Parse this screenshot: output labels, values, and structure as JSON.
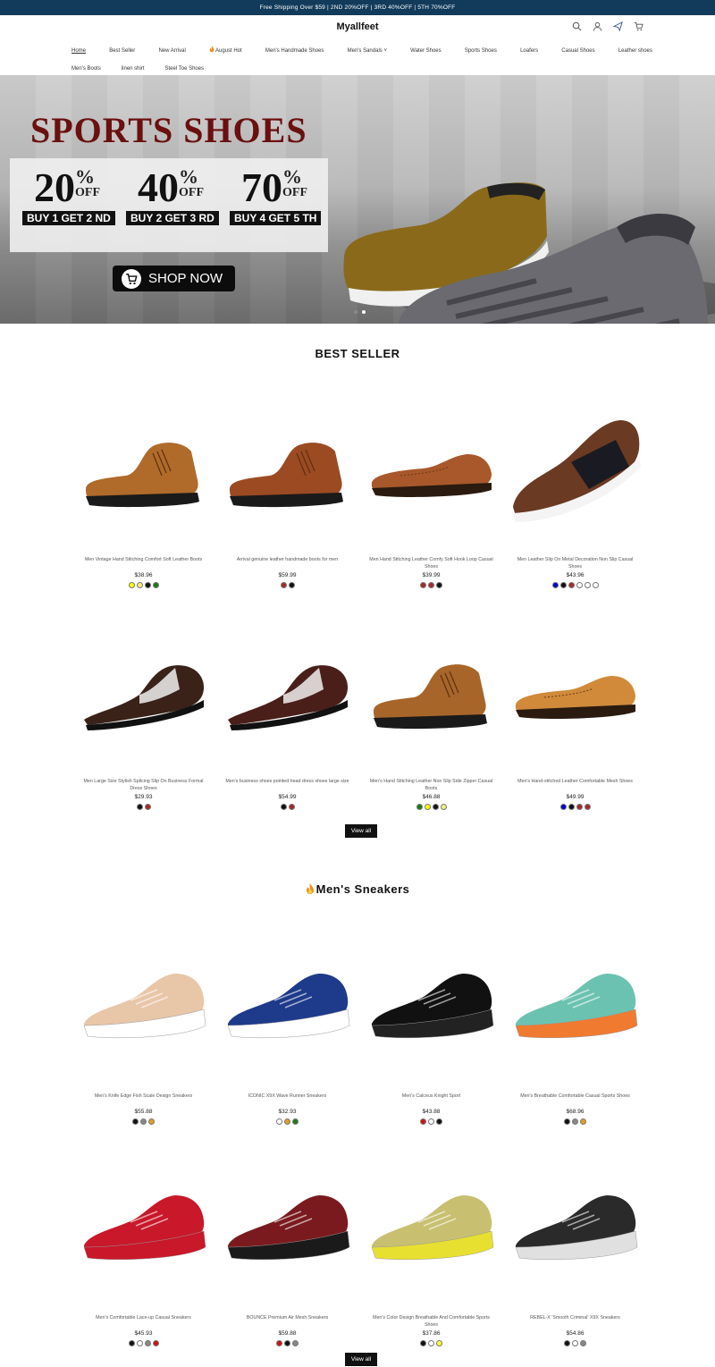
{
  "announcement": "Free Shipping Over $59 | 2ND 20%OFF | 3RD 40%OFF | 5TH 70%OFF",
  "brand": {
    "logo_text": "Myallfeet"
  },
  "nav": {
    "row1": [
      "Home",
      "Best Seller",
      "New Arrival",
      "August Hot",
      "Men's Handmade Shoes",
      "Men's Sandals",
      "Water Shoes",
      "Sports Shoes",
      "Loafers",
      "Casual Shoes",
      "Leather shoes"
    ],
    "row2": [
      "Men's Boots",
      "linen shirt",
      "Steel Toe Shoes"
    ]
  },
  "hero": {
    "title": "SPORTS SHOES",
    "offers": [
      {
        "pct": "20",
        "off": "OFF",
        "buy": "BUY 1 GET 2 ND"
      },
      {
        "pct": "40",
        "off": "OFF",
        "buy": "BUY 2 GET 3 RD"
      },
      {
        "pct": "70",
        "off": "OFF",
        "buy": "BUY 4 GET 5 TH"
      }
    ],
    "cta": "SHOP NOW",
    "slides": 2,
    "active_slide": 2
  },
  "best_seller": {
    "title": "BEST SELLER",
    "view_all": "View all",
    "products": [
      {
        "name": "Men Vintage Hand Stitching Comfort Soft Leather Boots",
        "price": "$38.96",
        "colors": [
          "#ffff00",
          "#f2ee7a",
          "#111111",
          "#1a7a1a"
        ],
        "shoe": {
          "type": "boot",
          "color": "#b06a2a"
        }
      },
      {
        "name": "Arrival genuine leather handmade boots for men",
        "price": "$59.99",
        "colors": [
          "#a52a2a",
          "#111111"
        ],
        "shoe": {
          "type": "boot",
          "color": "#9c4a22"
        }
      },
      {
        "name": "Men Hand Stitching Leather Comfy Soft Hook Loop Casual Shoes",
        "price": "$39.99",
        "colors": [
          "#a52a2a",
          "#a52a2a",
          "#111111"
        ],
        "shoe": {
          "type": "loafer",
          "color": "#a8582a"
        }
      },
      {
        "name": "Men Leather Slip On Metal Decoration Non Slip Casual Shoes",
        "price": "$43.96",
        "colors": [
          "#0000cc",
          "#111111",
          "#a52a2a",
          "#ffffff",
          "#ffffff",
          "#ffffff"
        ],
        "shoe": {
          "type": "slipon",
          "color": "#6b3a22"
        }
      },
      {
        "name": "Men Large Size Stylish Splicing Slip On Business Formal Dress Shoes",
        "price": "$29.93",
        "colors": [
          "#111111",
          "#a52a2a"
        ],
        "shoe": {
          "type": "dress",
          "color": "#3a2218"
        }
      },
      {
        "name": "Men's business shoes pointed head dress shoes large size",
        "price": "$54.99",
        "colors": [
          "#111111",
          "#a52a2a"
        ],
        "shoe": {
          "type": "dress",
          "color": "#4a1f1a"
        }
      },
      {
        "name": "Men's Hand Stitching Leather Non Slip Side Zipper Casual Boots",
        "price": "$46.88",
        "colors": [
          "#1a7a1a",
          "#ffff00",
          "#111111",
          "#f2ee7a"
        ],
        "shoe": {
          "type": "boot",
          "color": "#a8652a"
        }
      },
      {
        "name": "Men's Hand-stitched Leather Comfortable Mesh Shoes",
        "price": "$49.99",
        "colors": [
          "#0000cc",
          "#111111",
          "#a52a2a",
          "#a52a2a"
        ],
        "shoe": {
          "type": "loafer",
          "color": "#d08a3a"
        }
      }
    ]
  },
  "sneakers": {
    "title": "Men's Sneakers",
    "view_all": "View all",
    "products": [
      {
        "name": "Men's Knife Edge Fish Scale Design Sneakers",
        "price": "$55.88",
        "colors": [
          "#111111",
          "#888888",
          "#e0a020"
        ],
        "shoe": {
          "type": "sneaker",
          "color": "#e8c6a8",
          "sole": "#ffffff"
        }
      },
      {
        "name": "ICONIC X9X Wave Runner Sneakers",
        "price": "$32.93",
        "colors": [
          "#ffffff",
          "#e0a020",
          "#1a7a1a"
        ],
        "shoe": {
          "type": "sneaker",
          "color": "#1e3a8a",
          "sole": "#ffffff"
        }
      },
      {
        "name": "Men's Calceus Knight Sport",
        "price": "$43.88",
        "colors": [
          "#cc1111",
          "#ffffff",
          "#111111"
        ],
        "shoe": {
          "type": "sneaker",
          "color": "#111111",
          "sole": "#222222"
        }
      },
      {
        "name": "Men's Breathable Comfortable Casual Sports Shoes",
        "price": "$68.96",
        "colors": [
          "#111111",
          "#888888",
          "#e0a020"
        ],
        "shoe": {
          "type": "sneaker",
          "color": "#6cc2b0",
          "sole": "#f07a30"
        }
      },
      {
        "name": "Men's Comfortable Lace-up Casual Sneakers",
        "price": "$45.93",
        "colors": [
          "#111111",
          "#ffffff",
          "#888888",
          "#cc1111"
        ],
        "shoe": {
          "type": "sneaker",
          "color": "#c8182a",
          "sole": "#c8182a"
        }
      },
      {
        "name": "BOUNCE Premium Air Mesh Sneakers",
        "price": "$59.88",
        "colors": [
          "#cc1111",
          "#111111",
          "#888888"
        ],
        "shoe": {
          "type": "sneaker",
          "color": "#7a1a1e",
          "sole": "#1a1a1a"
        }
      },
      {
        "name": "Men's Color Design Breathable And Comfortable Sports Shoes",
        "price": "$37.86",
        "colors": [
          "#111111",
          "#ffffff",
          "#ffff33"
        ],
        "shoe": {
          "type": "sneaker",
          "color": "#c8c070",
          "sole": "#e8e030"
        }
      },
      {
        "name": "REBEL-X 'Smooth Criminal' X9X Sneakers",
        "price": "$54.86",
        "colors": [
          "#111111",
          "#ffffff",
          "#888888"
        ],
        "shoe": {
          "type": "sneaker",
          "color": "#2a2a2a",
          "sole": "#e0e0e0"
        }
      }
    ]
  }
}
